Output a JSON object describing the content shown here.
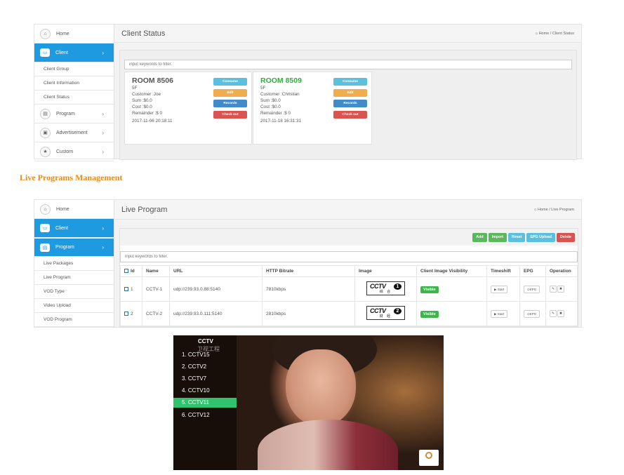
{
  "client_status_panel": {
    "sidebar": [
      {
        "label": "Home",
        "icon": "home-icon"
      },
      {
        "label": "Client",
        "icon": "monitor-icon",
        "active": true
      },
      {
        "label": "Client Group"
      },
      {
        "label": "Client Information"
      },
      {
        "label": "Client Status"
      },
      {
        "label": "Program",
        "icon": "film-icon"
      },
      {
        "label": "Advertisement",
        "icon": "image-icon"
      },
      {
        "label": "Custom",
        "icon": "star-icon"
      }
    ],
    "title": "Client Status",
    "breadcrumb": "Home / Client Status",
    "filter_placeholder": "input keywords to filter.",
    "rooms": [
      {
        "name": "ROOM 8506",
        "floor": "5F",
        "customer": "Customer :Joe",
        "sum": "Sum :$0.0",
        "cost": "Cost :$0.0",
        "remainder": "Remainder :$ 0",
        "time": "2017-11-06 20:18:11",
        "name_color": "#555555"
      },
      {
        "name": "ROOM 8509",
        "floor": "5F",
        "customer": "Customer :Christian",
        "sum": "Sum :$0.0",
        "cost": "Cost :$0.0",
        "remainder": "Remainder :$ 0",
        "time": "2017-11-18 16:31:31",
        "name_color": "#2fae3c"
      }
    ],
    "room_buttons": [
      {
        "label": "Consume",
        "color": "#5bc0de"
      },
      {
        "label": "Edit",
        "color": "#f0ad4e"
      },
      {
        "label": "Records",
        "color": "#428bca"
      },
      {
        "label": "Check out",
        "color": "#d9534f"
      }
    ]
  },
  "section_heading": "Live Programs Management",
  "live_program_panel": {
    "sidebar": [
      {
        "label": "Home",
        "icon": "home-icon"
      },
      {
        "label": "Client",
        "icon": "monitor-icon",
        "active": true
      },
      {
        "label": "Program",
        "icon": "film-icon",
        "active": true
      },
      {
        "label": "Live Packages"
      },
      {
        "label": "Live Program"
      },
      {
        "label": "VOD Type"
      },
      {
        "label": "Video Upload"
      },
      {
        "label": "VOD Program"
      }
    ],
    "title": "Live Program",
    "breadcrumb": "Home / Live Program",
    "toolbar": [
      {
        "label": "Add",
        "color": "#5cb85c"
      },
      {
        "label": "Import",
        "color": "#5cb85c"
      },
      {
        "label": "Reset",
        "color": "#5bc0de"
      },
      {
        "label": "EPG Upload",
        "color": "#5bc0de"
      },
      {
        "label": "Delete",
        "color": "#d9534f"
      }
    ],
    "filter_placeholder": "input keywords to filter.",
    "columns": [
      "Id",
      "Name",
      "URL",
      "HTTP Bitrate",
      "Image",
      "Client Image Visibility",
      "Timeshift",
      "EPG",
      "Operation"
    ],
    "rows": [
      {
        "id": "1",
        "name": "CCTV-1",
        "url": "udp://239.93.0.88:5140",
        "bitrate": "7810kbps",
        "logo_text": "CCTV",
        "logo_num": "1",
        "logo_sub": "综 合",
        "visibility": "Visible",
        "timeshift": "▶ Start",
        "epg": "⊙EPG"
      },
      {
        "id": "2",
        "name": "CCTV-2",
        "url": "udp://239.93.0.111:5140",
        "bitrate": "2810kbps",
        "logo_text": "CCTV",
        "logo_num": "2",
        "logo_sub": "财 经",
        "visibility": "Visible",
        "timeshift": "▶ Start",
        "epg": "⊙EPG"
      }
    ]
  },
  "tv_menu": {
    "header": "CCTV",
    "watermark": "卫视工程",
    "channels": [
      "1. CCTV15",
      "2. CCTV2",
      "3. CCTV7",
      "4. CCTV10",
      "5. CCTV11",
      "6. CCTV12"
    ],
    "selected_index": 4,
    "selected_color": "#2fc36e"
  }
}
